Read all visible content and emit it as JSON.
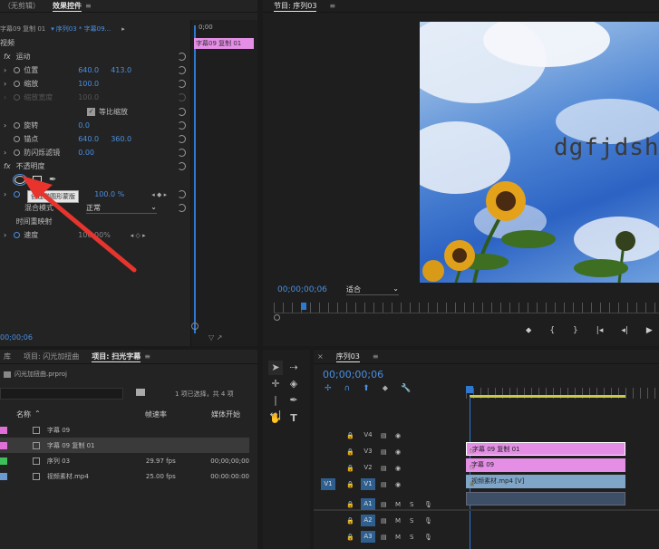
{
  "effect_controls": {
    "tabs": [
      "（无剪辑）",
      "效果控件"
    ],
    "clip_path": "字幕09 复制 01",
    "sequence_clip": "序列03 * 字幕09...",
    "timecode": "0;00",
    "clip_label": "字幕09 复制 01",
    "section_video": "视频",
    "motion": {
      "label": "运动"
    },
    "position": {
      "label": "位置",
      "x": "640.0",
      "y": "413.0"
    },
    "scale": {
      "label": "缩放",
      "value": "100.0"
    },
    "scale_width": {
      "label": "缩放宽度",
      "value": "100.0"
    },
    "uniform_scale": {
      "label": "等比缩放",
      "checked": true
    },
    "rotation": {
      "label": "旋转",
      "value": "0.0"
    },
    "anchor": {
      "label": "锚点",
      "x": "640.0",
      "y": "360.0"
    },
    "flicker": {
      "label": "防闪烁滤镜",
      "value": "0.00"
    },
    "opacity": {
      "label": "不透明度",
      "value": "100.0 %"
    },
    "blend_label": "混合模式",
    "blend_value": "正常",
    "tooltip": "创建椭圆形蒙版",
    "time_remap": {
      "label": "时间重映射"
    },
    "speed": {
      "label": "速度",
      "value": "100.00%"
    },
    "bottom_timecode": "00;00;06"
  },
  "program": {
    "title": "节目: 序列03",
    "overlay_text": "dgfjdshgl",
    "timecode": "00;00;00;06",
    "fit": "适合"
  },
  "project": {
    "tabs": [
      "库",
      "项目: 闪光加扭曲",
      "项目: 扫光字幕"
    ],
    "filename": "闪光加扭曲.prproj",
    "selection_info": "1 项已选择，共 4 项",
    "columns": {
      "name": "名称",
      "fps": "帧速率",
      "media_start": "媒体开始"
    },
    "rows": [
      {
        "color": "#e070d8",
        "name": "字幕 09",
        "fps": "",
        "start": ""
      },
      {
        "color": "#e070d8",
        "name": "字幕 09 复制 01",
        "fps": "",
        "start": ""
      },
      {
        "color": "#3fbf5a",
        "name": "序列 03",
        "fps": "29.97 fps",
        "start": "00;00;00;00"
      },
      {
        "color": "#6a9ad0",
        "name": "视频素材.mp4",
        "fps": "25.00 fps",
        "start": "00:00:00:00"
      }
    ]
  },
  "timeline": {
    "tab": "序列03",
    "timecode": "00;00;00;06",
    "tracks": [
      {
        "id": "V4",
        "src": ""
      },
      {
        "id": "V3",
        "src": ""
      },
      {
        "id": "V2",
        "src": ""
      },
      {
        "id": "V1",
        "src": "V1"
      },
      {
        "id": "A1",
        "src": ""
      },
      {
        "id": "A2",
        "src": ""
      },
      {
        "id": "A3",
        "src": ""
      }
    ],
    "clips": {
      "v3": "字幕 09 复制 01",
      "v2": "字幕 09",
      "v1": "视频素材.mp4 [V]"
    },
    "track_letters": {
      "m": "M",
      "s": "S"
    }
  }
}
